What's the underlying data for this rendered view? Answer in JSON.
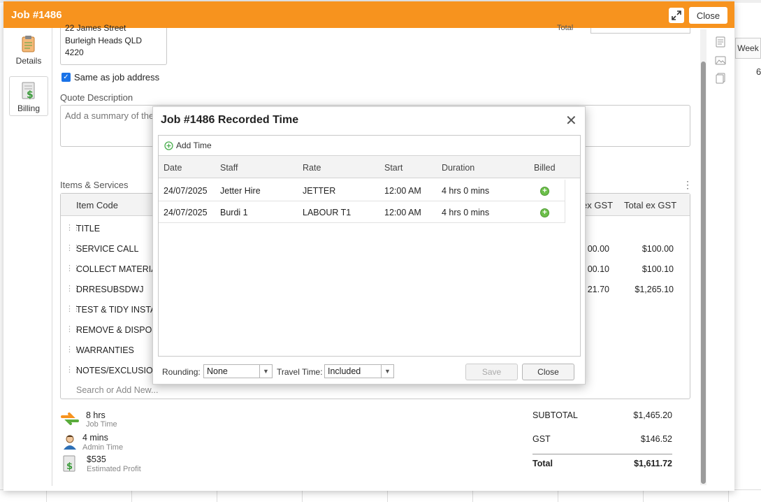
{
  "main_window": {
    "title": "Job #1486",
    "close_label": "Close",
    "tabs": [
      {
        "label": "Details"
      },
      {
        "label": "Billing"
      }
    ],
    "address_lines": [
      "22 James Street",
      "Burleigh Heads QLD",
      "4220"
    ],
    "total_label": "Total",
    "same_as_job_address": "Same as job address",
    "quote_description_label": "Quote Description",
    "quote_description_placeholder": "Add a summary of the",
    "items_label": "Items & Services",
    "items_headers": {
      "item_code": "Item Code",
      "ex_gst": "ex GST",
      "total_ex_gst": "Total ex GST"
    },
    "items": [
      {
        "code": "TITLE",
        "ex": "",
        "total": ""
      },
      {
        "code": "SERVICE CALL",
        "ex": "00.00",
        "total": "$100.00"
      },
      {
        "code": "COLLECT MATERIAL",
        "ex": "00.10",
        "total": "$100.10"
      },
      {
        "code": "DRRESUBSDWJ",
        "ex": "21.70",
        "total": "$1,265.10"
      },
      {
        "code": "TEST & TIDY INSTAL",
        "ex": "",
        "total": ""
      },
      {
        "code": "REMOVE & DISPOSE",
        "ex": "",
        "total": ""
      },
      {
        "code": "WARRANTIES",
        "ex": "",
        "total": ""
      },
      {
        "code": "NOTES/EXCLUSIONS",
        "ex": "",
        "total": ""
      }
    ],
    "search_add_placeholder": "Search or Add New...",
    "stats": [
      {
        "value": "8 hrs",
        "label": "Job Time",
        "icon": "arrows-icon"
      },
      {
        "value": "4 mins",
        "label": "Admin Time",
        "icon": "admin-user-icon"
      },
      {
        "value": "$535",
        "label": "Estimated Profit",
        "icon": "profit-document-icon"
      }
    ],
    "summary": {
      "subtotal_label": "SUBTOTAL",
      "subtotal": "$1,465.20",
      "gst_label": "GST",
      "gst": "$146.52",
      "total_label": "Total",
      "total": "$1,611.72"
    }
  },
  "background": {
    "week_label": "Week",
    "week_value": "6"
  },
  "modal": {
    "title": "Job #1486 Recorded Time",
    "add_time_label": "Add Time",
    "headers": {
      "date": "Date",
      "staff": "Staff",
      "rate": "Rate",
      "start": "Start",
      "duration": "Duration",
      "billed": "Billed"
    },
    "rows": [
      {
        "date": "24/07/2025",
        "staff": "Jetter Hire",
        "rate": "JETTER",
        "start": "12:00 AM",
        "duration": "4 hrs 0 mins"
      },
      {
        "date": "24/07/2025",
        "staff": "Burdi 1",
        "rate": "LABOUR T1",
        "start": "12:00 AM",
        "duration": "4 hrs 0 mins"
      }
    ],
    "rounding_label": "Rounding:",
    "rounding_value": "None",
    "travel_time_label": "Travel Time:",
    "travel_time_value": "Included",
    "save_label": "Save",
    "close_label": "Close"
  },
  "colors": {
    "title_bar": "#f7931e",
    "billed_plus": "#6cbf4a",
    "checkbox": "#1a73e8"
  }
}
